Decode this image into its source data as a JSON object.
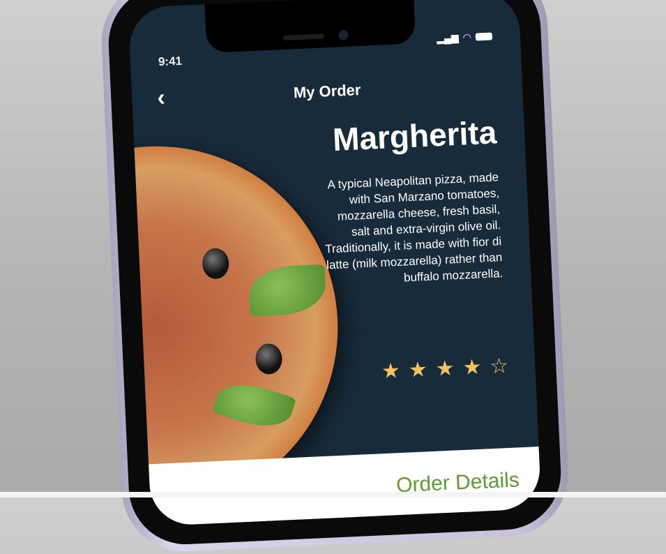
{
  "status_bar": {
    "time": "9:41",
    "signal_icon": "signal-icon",
    "wifi_icon": "wifi-icon",
    "battery_icon": "battery-icon"
  },
  "header": {
    "title": "My Order",
    "back_icon": "chevron-left-icon"
  },
  "product": {
    "name": "Margherita",
    "description": "A typical Neapolitan pizza, made with San Marzano tomatoes, mozzarella cheese, fresh basil, salt and extra-virgin olive oil. Traditionally, it is made with fior di latte (milk mozzarella) rather than buffalo mozzarella.",
    "rating": 4,
    "rating_max": 5,
    "star_color": "#f2c25e"
  },
  "order_details": {
    "label": "Order Details",
    "color": "#5d9c33"
  },
  "colors": {
    "background": "#182b3a"
  }
}
